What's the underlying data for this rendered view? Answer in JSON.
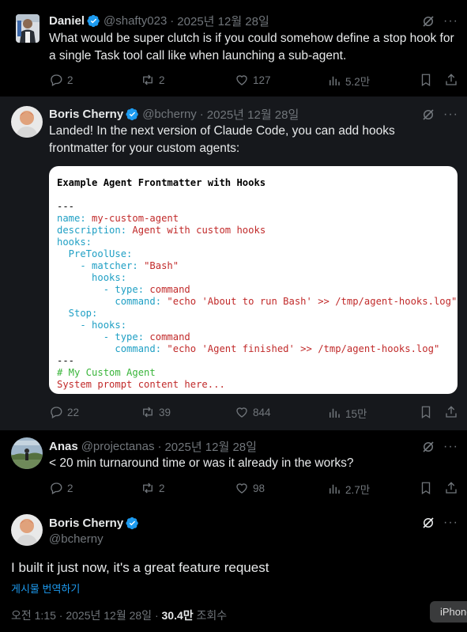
{
  "tweets": [
    {
      "name": "Daniel",
      "handle": "@shafty023",
      "time": "2025년 12월 28일",
      "text": "What would be super clutch is if you could somehow define a stop hook for a single Task tool call like when launching a sub-agent.",
      "replies": "2",
      "reposts": "2",
      "likes": "127",
      "views": "5.2만"
    },
    {
      "name": "Boris Cherny",
      "handle": "@bcherny",
      "time": "2025년 12월 28일",
      "text": "Landed! In the next version of Claude Code, you can add hooks frontmatter for your custom agents:",
      "replies": "22",
      "reposts": "39",
      "likes": "844",
      "views": "15만",
      "code": {
        "title": "Example Agent Frontmatter with Hooks",
        "lines": [
          {
            "k": "",
            "v": "---",
            "type": "dash"
          },
          {
            "k": "name: ",
            "v": "my-custom-agent"
          },
          {
            "k": "description: ",
            "v": "Agent with custom hooks"
          },
          {
            "k": "hooks:",
            "v": ""
          },
          {
            "k": "  PreToolUse:",
            "v": ""
          },
          {
            "k": "    - matcher: ",
            "v": "\"Bash\""
          },
          {
            "k": "      hooks:",
            "v": ""
          },
          {
            "k": "        - type: ",
            "v": "command"
          },
          {
            "k": "          command: ",
            "v": "\"echo 'About to run Bash' >> /tmp/agent-hooks.log\""
          },
          {
            "k": "  Stop:",
            "v": ""
          },
          {
            "k": "    - hooks:",
            "v": ""
          },
          {
            "k": "        - type: ",
            "v": "command"
          },
          {
            "k": "          command: ",
            "v": "\"echo 'Agent finished' >> /tmp/agent-hooks.log\""
          },
          {
            "k": "",
            "v": "---",
            "type": "dash"
          },
          {
            "k": "",
            "v": "# My Custom Agent",
            "type": "comment"
          },
          {
            "k": "",
            "v": "System prompt content here...",
            "type": "val"
          }
        ]
      }
    },
    {
      "name": "Anas",
      "handle": "@projectanas",
      "time": "2025년 12월 28일",
      "text": "< 20 min turnaround time or was it already in the works?",
      "replies": "2",
      "reposts": "2",
      "likes": "98",
      "views": "2.7만"
    }
  ],
  "main": {
    "name": "Boris Cherny",
    "handle": "@bcherny",
    "text": "I built it just now, it's a great feature request",
    "translate": "게시물 번역하기",
    "time": "오전 1:15 · 2025년 12월 28일",
    "views_count": "30.4만",
    "views_label": "조회수"
  },
  "overlay": {
    "label": "iPhone"
  },
  "colors": {
    "accent": "#1d9bf0",
    "muted": "#71767b",
    "key": "#1e9fc4",
    "value": "#c12a2a",
    "comment": "#39b53a"
  },
  "icons": [
    "verified-badge-icon",
    "grok-icon",
    "more-icon",
    "reply-icon",
    "repost-icon",
    "like-icon",
    "views-icon",
    "bookmark-icon",
    "share-icon"
  ]
}
